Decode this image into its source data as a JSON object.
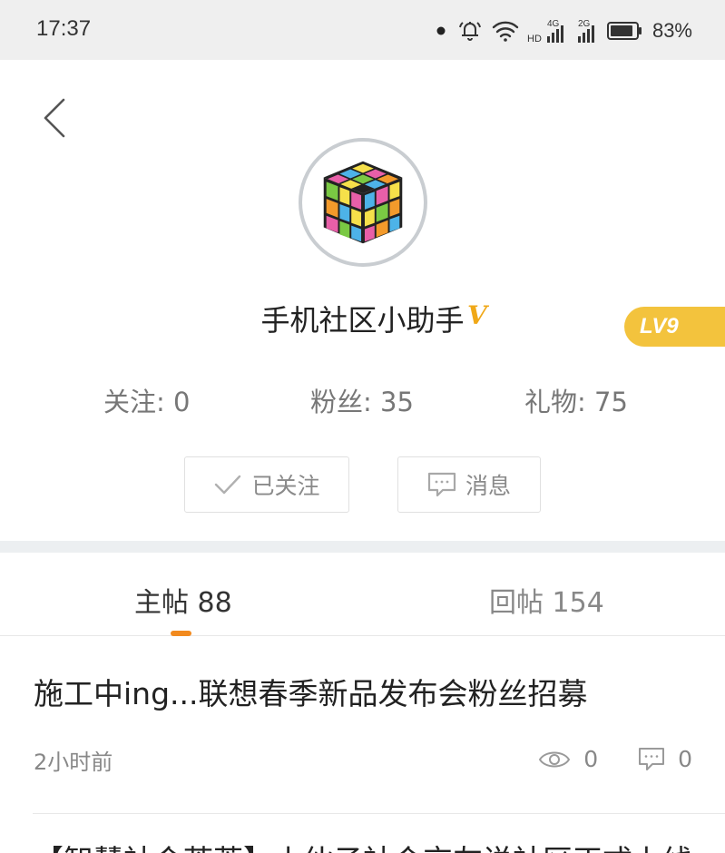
{
  "status_bar": {
    "time": "17:37",
    "battery_percent": "83%",
    "icons": [
      "notification-dot-icon",
      "bell-icon",
      "wifi-icon",
      "hd-4g-signal-icon",
      "2g-signal-icon",
      "battery-icon"
    ],
    "network_4g_label": "4G",
    "network_2g_label": "2G",
    "hd_label": "HD"
  },
  "profile": {
    "username": "手机社区小助手",
    "verified_badge": "V",
    "level": "LV9",
    "level_color": "#f3c33d",
    "verified_color": "#f0a818",
    "avatar": "rubiks-cube-avatar"
  },
  "stats": {
    "following": "关注: 0",
    "fans": "粉丝: 35",
    "gifts": "礼物: 75"
  },
  "actions": {
    "follow_label": "已关注",
    "message_label": "消息"
  },
  "tabs": {
    "posts": "主帖 88",
    "replies": "回帖 154",
    "active_color": "#f28a1e"
  },
  "posts": [
    {
      "title": "施工中ing...联想春季新品发布会粉丝招募",
      "time": "2小时前",
      "views": "0",
      "comments": "0"
    },
    {
      "title": "【智慧社会荟萃】小伙子社会交友说社区正式上线"
    }
  ]
}
